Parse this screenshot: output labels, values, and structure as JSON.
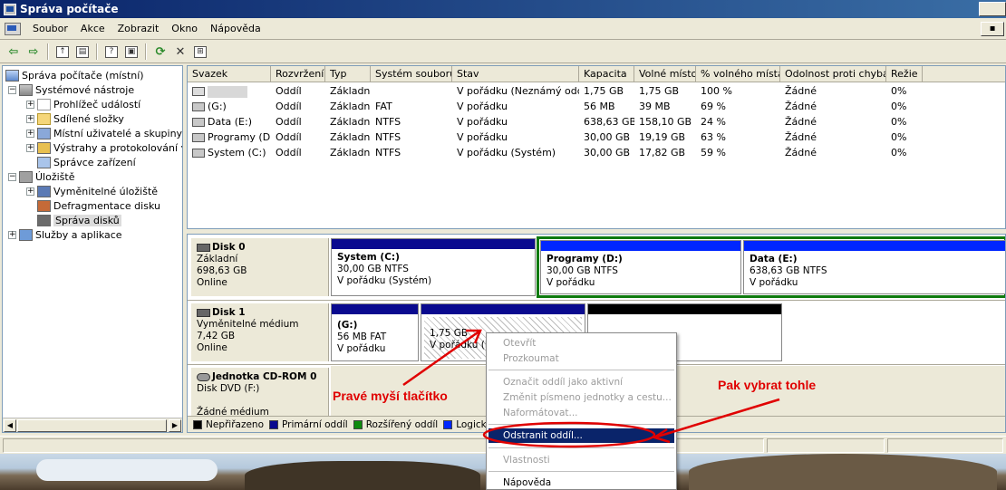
{
  "window": {
    "title": "Správa počítače"
  },
  "menu": {
    "items": [
      "Soubor",
      "Akce",
      "Zobrazit",
      "Okno",
      "Nápověda"
    ],
    "mdi_button": "▪"
  },
  "toolbar": {
    "icons": [
      "back-icon",
      "forward-icon",
      "up-folder-icon",
      "show-hide-tree-icon",
      "properties-icon",
      "help-icon",
      "refresh-icon",
      "delete-icon",
      "export-icon"
    ]
  },
  "tree": {
    "root": "Správa počítače (místní)",
    "system_tools": "Systémové nástroje",
    "event_viewer": "Prohlížeč událostí",
    "shared_folders": "Sdílené složky",
    "local_users": "Místní uživatelé a skupiny",
    "alerts": "Výstrahy a protokolování vý",
    "device_manager": "Správce zařízení",
    "storage": "Úložiště",
    "removable_storage": "Vyměnitelné úložiště",
    "defrag": "Defragmentace disku",
    "disk_management": "Správa disků",
    "services": "Služby a aplikace"
  },
  "volumes": {
    "headers": [
      "Svazek",
      "Rozvržení",
      "Typ",
      "Systém souborů",
      "Stav",
      "Kapacita",
      "Volné místo",
      "% volného místa",
      "Odolnost proti chybám",
      "Režie"
    ],
    "rows": [
      {
        "name": "",
        "layout": "Oddíl",
        "type": "Základní",
        "fs": "",
        "status": "V pořádku (Neznámý oddíl)",
        "capacity": "1,75 GB",
        "free": "1,75 GB",
        "pct": "100 %",
        "fault": "Žádné",
        "overhead": "0%"
      },
      {
        "name": "(G:)",
        "layout": "Oddíl",
        "type": "Základní",
        "fs": "FAT",
        "status": "V pořádku",
        "capacity": "56 MB",
        "free": "39 MB",
        "pct": "69 %",
        "fault": "Žádné",
        "overhead": "0%"
      },
      {
        "name": "Data (E:)",
        "layout": "Oddíl",
        "type": "Základní",
        "fs": "NTFS",
        "status": "V pořádku",
        "capacity": "638,63 GB",
        "free": "158,10 GB",
        "pct": "24 %",
        "fault": "Žádné",
        "overhead": "0%"
      },
      {
        "name": "Programy (D:)",
        "layout": "Oddíl",
        "type": "Základní",
        "fs": "NTFS",
        "status": "V pořádku",
        "capacity": "30,00 GB",
        "free": "19,19 GB",
        "pct": "63 %",
        "fault": "Žádné",
        "overhead": "0%"
      },
      {
        "name": "System (C:)",
        "layout": "Oddíl",
        "type": "Základní",
        "fs": "NTFS",
        "status": "V pořádku (Systém)",
        "capacity": "30,00 GB",
        "free": "17,82 GB",
        "pct": "59 %",
        "fault": "Žádné",
        "overhead": "0%"
      }
    ]
  },
  "disks": {
    "disk0": {
      "name": "Disk 0",
      "type": "Základní",
      "size": "698,63 GB",
      "status": "Online",
      "partitions": [
        {
          "name": "System  (C:)",
          "detail": "30,00 GB NTFS",
          "status": "V pořádku (Systém)"
        },
        {
          "name": "Programy  (D:)",
          "detail": "30,00 GB NTFS",
          "status": "V pořádku"
        },
        {
          "name": "Data  (E:)",
          "detail": "638,63 GB NTFS",
          "status": "V pořádku"
        }
      ]
    },
    "disk1": {
      "name": "Disk 1",
      "type": "Vyměnitelné médium",
      "size": "7,42 GB",
      "status": "Online",
      "partitions": [
        {
          "name": "(G:)",
          "detail": "56 MB FAT",
          "status": "V pořádku"
        },
        {
          "detail": "1,75 GB",
          "status": "V pořádku (Ne"
        }
      ]
    },
    "cdrom": {
      "name": "Jednotka CD-ROM 0",
      "type": "Disk DVD (F:)",
      "status": "Žádné médium"
    }
  },
  "legend": {
    "unallocated": "Nepřiřazeno",
    "primary": "Primární oddíl",
    "extended": "Rozšířený oddíl",
    "logical": "Logická j"
  },
  "context_menu": {
    "open": "Otevřít",
    "explore": "Prozkoumat",
    "mark_active": "Označit oddíl jako aktivní",
    "change_letter": "Změnit písmeno jednotky a cestu...",
    "format": "Naformátovat...",
    "delete": "Odstranit oddíl...",
    "properties": "Vlastnosti",
    "help": "Nápověda"
  },
  "annotations": {
    "right_click": "Pravé myší tlačítko",
    "then_select": "Pak vybrat tohle",
    "color": "#e00000"
  },
  "colors": {
    "primary": "#0a0a8f",
    "selection": "#0e7a0e",
    "highlight": "#0a246a",
    "logical": "#0026ff",
    "extended": "#0e8a0e"
  }
}
